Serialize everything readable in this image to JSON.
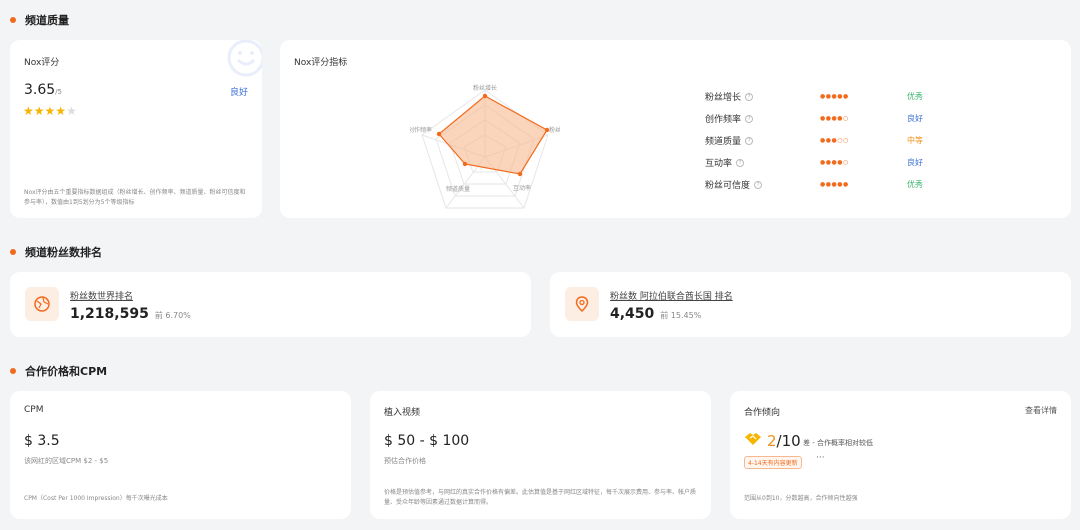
{
  "sections": {
    "quality": "频道质量",
    "ranking": "频道粉丝数排名",
    "pricing": "合作价格和CPM"
  },
  "nox_score": {
    "title": "Nox评分",
    "value": "3.65",
    "unit": "/5",
    "rating": 3.65,
    "grade": "良好",
    "note": "Nox评分由五个重要指标数据组成（粉丝增长、创作频率、频道质量、粉丝可信度和参与率），数值由1到5划分为5个等级指标"
  },
  "indicators": {
    "title": "Nox评分指标",
    "radar_labels": {
      "top": "粉丝增长",
      "right": "粉丝可信度",
      "bottom_right": "互动率",
      "bottom_left": "频道质量",
      "left": "创作频率"
    },
    "metrics": [
      {
        "name": "粉丝增长",
        "dots": "●●●●●",
        "grade": "优秀",
        "color": "#3cb371",
        "score": 5
      },
      {
        "name": "创作频率",
        "dots": "●●●●○",
        "grade": "良好",
        "color": "#3a6fd8",
        "score": 4
      },
      {
        "name": "频道质量",
        "dots": "●●●○○",
        "grade": "中等",
        "color": "#f2911b",
        "score": 3
      },
      {
        "name": "互动率",
        "dots": "●●●●○",
        "grade": "良好",
        "color": "#3a6fd8",
        "score": 4
      },
      {
        "name": "粉丝可信度",
        "dots": "●●●●●",
        "grade": "优秀",
        "color": "#3cb371",
        "score": 5
      }
    ]
  },
  "ranks": {
    "world": {
      "label": "粉丝数世界排名",
      "value": "1,218,595",
      "pct": "前 6.70%"
    },
    "country": {
      "label": "粉丝数 阿拉伯联合酋长国 排名",
      "value": "4,450",
      "pct": "前 15.45%"
    }
  },
  "cpm": {
    "title": "CPM",
    "value": "$ 3.5",
    "sub": "该网红的区域CPM $2 - $5",
    "note": "CPM（Cost Per 1000 Impression）每千次曝光成本"
  },
  "embed": {
    "title": "植入视频",
    "value": "$ 50 - $ 100",
    "sub": "预估合作价格",
    "note": "价格是预估值参考，与网红的真实合作价格有偏差。此估算值是基于网红区域特征，每千次展示费用、参与率、帐户质量、受众年龄等因素通过数据计算而得。"
  },
  "tendency": {
    "title": "合作倾向",
    "detail_link": "查看详情",
    "value": "2",
    "total": "/10",
    "desc": "差 - 合作概率相对较低",
    "tag": "4-14天有内容更新",
    "more": "···",
    "note": "范围从0到10，分数越高，合作倾向性越强"
  }
}
